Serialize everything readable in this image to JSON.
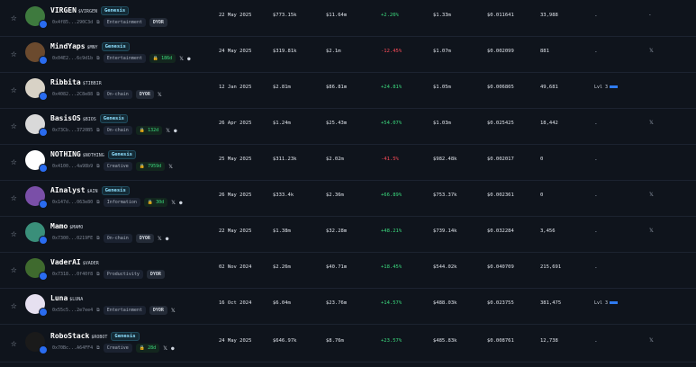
{
  "rows": [
    {
      "name": "VIRGEN",
      "ticker": "$VIRGEN",
      "genesis": "Genesis",
      "address": "0x4f85...290C3d",
      "tags": [
        "Entertainment"
      ],
      "dyor": "DYOR",
      "green_tag": "",
      "socials": [],
      "date": "22 May 2025",
      "mcap": "$773.15k",
      "vol": "$11.64m",
      "change": "+2.26%",
      "change_dir": "pos",
      "liq": "$1.33m",
      "price": "$0.011641",
      "holders": "33,988",
      "level": "-",
      "extra": "-",
      "x_link": "",
      "avatar_color": "#3e7a3e"
    },
    {
      "name": "MindYaps",
      "ticker": "$MNY",
      "genesis": "Genesis",
      "address": "0x04E2...6c9d1b",
      "tags": [
        "Entertainment"
      ],
      "dyor": "",
      "green_tag": "186d",
      "socials": [
        "X",
        "globe"
      ],
      "date": "24 May 2025",
      "mcap": "$319.81k",
      "vol": "$2.1m",
      "change": "-12.45%",
      "change_dir": "neg",
      "liq": "$1.07m",
      "price": "$0.002099",
      "holders": "881",
      "level": "-",
      "extra": "",
      "x_link": "X",
      "avatar_color": "#6b4a2e"
    },
    {
      "name": "Ribbita",
      "ticker": "$TIBBIR",
      "genesis": "",
      "address": "0x4082...2C8e88",
      "tags": [
        "On-chain"
      ],
      "dyor": "DYOR",
      "green_tag": "",
      "socials": [
        "X"
      ],
      "date": "12 Jan 2025",
      "mcap": "$2.81m",
      "vol": "$86.81m",
      "change": "+24.81%",
      "change_dir": "pos",
      "liq": "$1.05m",
      "price": "$0.006805",
      "holders": "49,681",
      "level": "Lvl 3",
      "extra": "",
      "x_link": "",
      "avatar_color": "#d8d2c6"
    },
    {
      "name": "BasisOS",
      "ticker": "$BIOS",
      "genesis": "Genesis",
      "address": "0x73Cb...3720B5",
      "tags": [
        "On-chain"
      ],
      "dyor": "",
      "green_tag": "132d",
      "socials": [
        "X",
        "globe"
      ],
      "date": "26 Apr 2025",
      "mcap": "$1.24m",
      "vol": "$25.43m",
      "change": "+54.07%",
      "change_dir": "pos",
      "liq": "$1.03m",
      "price": "$0.025425",
      "holders": "18,442",
      "level": "-",
      "extra": "",
      "x_link": "X",
      "avatar_color": "#d9d9d9"
    },
    {
      "name": "NOTHING",
      "ticker": "$NOTHING",
      "genesis": "Genesis",
      "address": "0x4100...4a98b9",
      "tags": [
        "Creative"
      ],
      "dyor": "",
      "green_tag": "7959d",
      "socials": [
        "X"
      ],
      "date": "25 May 2025",
      "mcap": "$311.23k",
      "vol": "$2.02m",
      "change": "-41.5%",
      "change_dir": "neg",
      "liq": "$982.48k",
      "price": "$0.002017",
      "holders": "0",
      "level": "-",
      "extra": "",
      "x_link": "",
      "avatar_color": "#ffffff"
    },
    {
      "name": "AInalyst",
      "ticker": "$AIN",
      "genesis": "Genesis",
      "address": "0x147d...063e80",
      "tags": [
        "Information"
      ],
      "dyor": "",
      "green_tag": "30d",
      "socials": [
        "X",
        "globe"
      ],
      "date": "26 May 2025",
      "mcap": "$333.4k",
      "vol": "$2.36m",
      "change": "+66.89%",
      "change_dir": "pos",
      "liq": "$753.37k",
      "price": "$0.002361",
      "holders": "0",
      "level": "-",
      "extra": "",
      "x_link": "X",
      "avatar_color": "#7a4fa8"
    },
    {
      "name": "Mamo",
      "ticker": "$MAMO",
      "genesis": "",
      "address": "0x7300...0219FE",
      "tags": [
        "On-chain"
      ],
      "dyor": "DYOR",
      "green_tag": "",
      "socials": [
        "X",
        "globe"
      ],
      "date": "22 May 2025",
      "mcap": "$1.38m",
      "vol": "$32.28m",
      "change": "+48.21%",
      "change_dir": "pos",
      "liq": "$739.14k",
      "price": "$0.032284",
      "holders": "3,456",
      "level": "-",
      "extra": "",
      "x_link": "X",
      "avatar_color": "#3a8f7a"
    },
    {
      "name": "VaderAI",
      "ticker": "$VADER",
      "genesis": "",
      "address": "0x7318...0f40f8",
      "tags": [
        "Productivity"
      ],
      "dyor": "DYOR",
      "green_tag": "",
      "socials": [],
      "date": "02 Nov 2024",
      "mcap": "$2.26m",
      "vol": "$40.71m",
      "change": "+18.45%",
      "change_dir": "pos",
      "liq": "$544.02k",
      "price": "$0.040709",
      "holders": "215,691",
      "level": "-",
      "extra": "",
      "x_link": "",
      "avatar_color": "#3f6a2e"
    },
    {
      "name": "Luna",
      "ticker": "$LUNA",
      "genesis": "",
      "address": "0x55c5...2e7ee4",
      "tags": [
        "Entertainment"
      ],
      "dyor": "DYOR",
      "green_tag": "",
      "socials": [
        "X"
      ],
      "date": "16 Oct 2024",
      "mcap": "$6.04m",
      "vol": "$23.76m",
      "change": "+14.57%",
      "change_dir": "pos",
      "liq": "$488.03k",
      "price": "$0.023755",
      "holders": "381,475",
      "level": "Lvl 3",
      "extra": "",
      "x_link": "",
      "avatar_color": "#e6e0f0"
    },
    {
      "name": "RoboStack",
      "ticker": "$ROBOT",
      "genesis": "Genesis",
      "address": "0x70Bc...A64FF4",
      "tags": [
        "Creative"
      ],
      "dyor": "",
      "green_tag": "28d",
      "socials": [
        "X",
        "globe"
      ],
      "date": "24 May 2025",
      "mcap": "$646.97k",
      "vol": "$8.76m",
      "change": "+23.57%",
      "change_dir": "pos",
      "liq": "$485.83k",
      "price": "$0.008761",
      "holders": "12,738",
      "level": "-",
      "extra": "",
      "x_link": "X",
      "avatar_color": "#1a1a1a"
    }
  ]
}
